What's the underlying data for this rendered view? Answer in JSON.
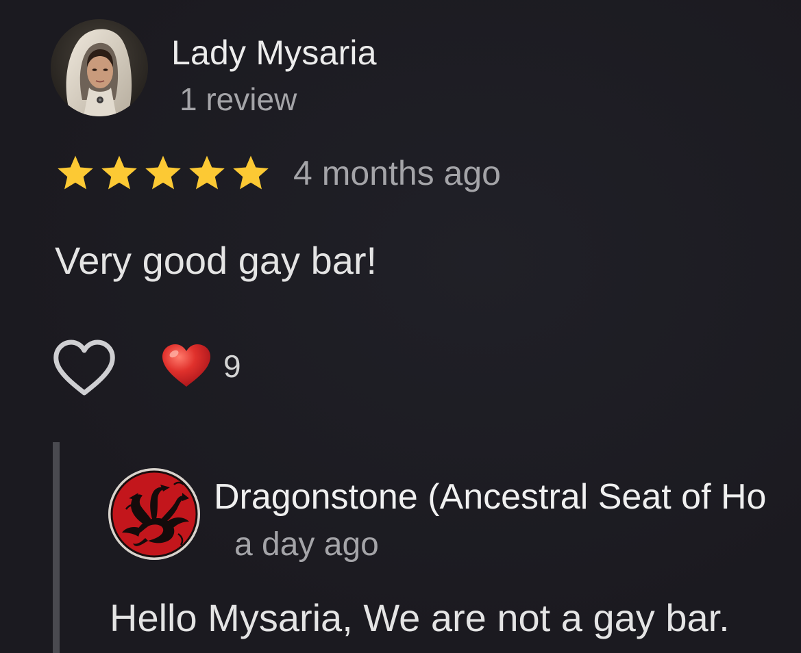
{
  "review": {
    "reviewer_name": "Lady Mysaria",
    "reviewer_meta": "1 review",
    "rating": 5,
    "rating_max": 5,
    "time": "4 months ago",
    "text": "Very good gay bar!",
    "reaction_emoji": "red-heart",
    "reaction_count": "9"
  },
  "owner_reply": {
    "name": "Dragonstone (Ancestral Seat of Ho",
    "time": "a day ago",
    "text": "Hello Mysaria, We are not a gay bar."
  },
  "icons": {
    "like": "heart-outline-icon",
    "reaction": "heart-emoji-icon",
    "star": "star-icon"
  },
  "colors": {
    "background": "#1c1b21",
    "star": "#fcc934",
    "heart_emoji": "#e0312c",
    "muted_text": "#a4a4a8",
    "reply_bar": "#4a4a50",
    "sigil_red": "#c3161c"
  }
}
